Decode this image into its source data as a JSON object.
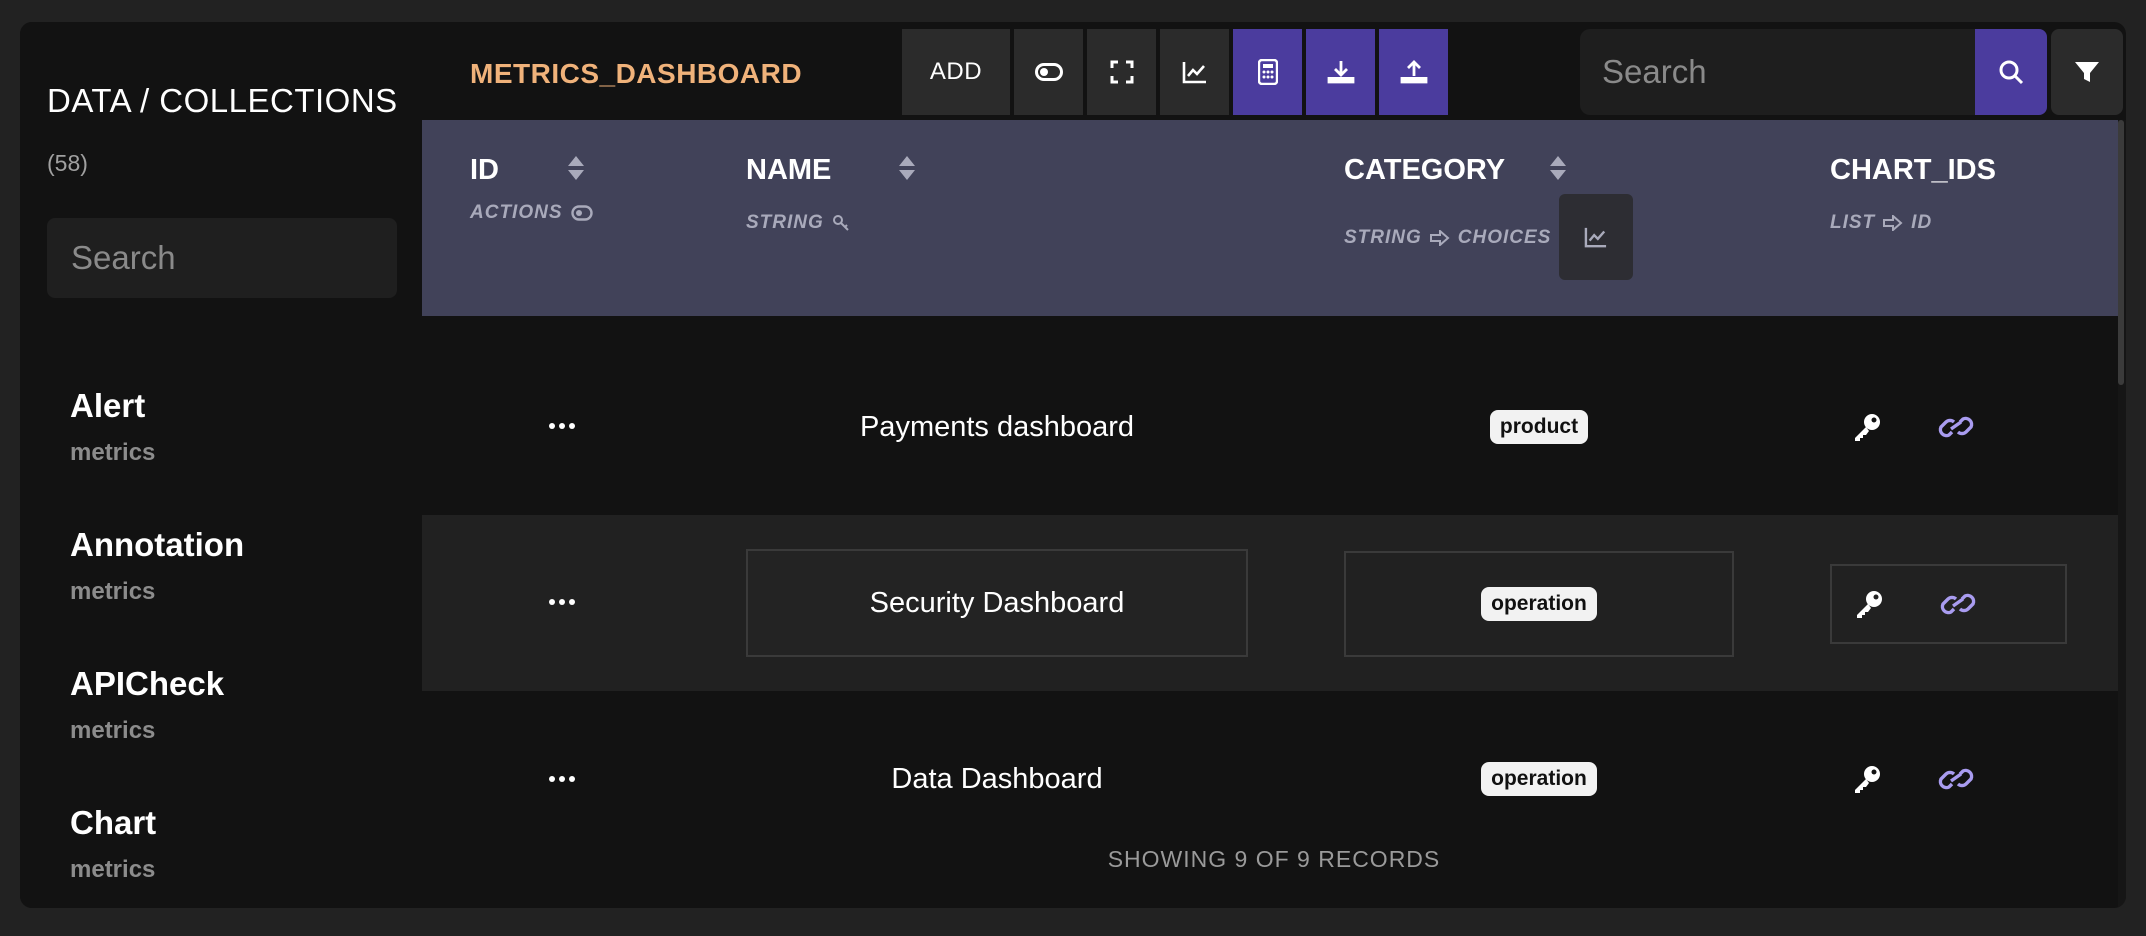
{
  "sidebar": {
    "title": "DATA / COLLECTIONS",
    "count": "(58)",
    "search_placeholder": "Search",
    "items": [
      {
        "name": "Alert",
        "sub": "metrics"
      },
      {
        "name": "Annotation",
        "sub": "metrics"
      },
      {
        "name": "APICheck",
        "sub": "metrics"
      },
      {
        "name": "Chart",
        "sub": "metrics"
      }
    ]
  },
  "header": {
    "collection_title": "METRICS_DASHBOARD",
    "add_label": "ADD",
    "toolbar_icons": [
      "toggle-icon",
      "expand-icon",
      "chart-line-icon",
      "calculator-icon",
      "download-icon",
      "upload-icon"
    ],
    "search_placeholder": "Search"
  },
  "columns": [
    {
      "title": "ID",
      "sub": "ACTIONS",
      "sub_icon": "toggle-icon"
    },
    {
      "title": "NAME",
      "sub": "STRING",
      "sub_icon": "key-icon"
    },
    {
      "title": "CATEGORY",
      "sub": "STRING",
      "sub_arrow": "CHOICES"
    },
    {
      "title": "CHART_IDS",
      "sub": "LIST",
      "sub_arrow": "ID"
    }
  ],
  "rows": [
    {
      "name": "Payments dashboard",
      "category": "product"
    },
    {
      "name": "Security Dashboard",
      "category": "operation"
    },
    {
      "name": "Data Dashboard",
      "category": "operation"
    }
  ],
  "footer": {
    "records_text": "SHOWING 9 OF 9 RECORDS"
  },
  "colors": {
    "accent": "#4b3c9e",
    "title_orange": "#f0b27a",
    "header_bg": "#414259",
    "link_purple": "#a99cf0"
  }
}
